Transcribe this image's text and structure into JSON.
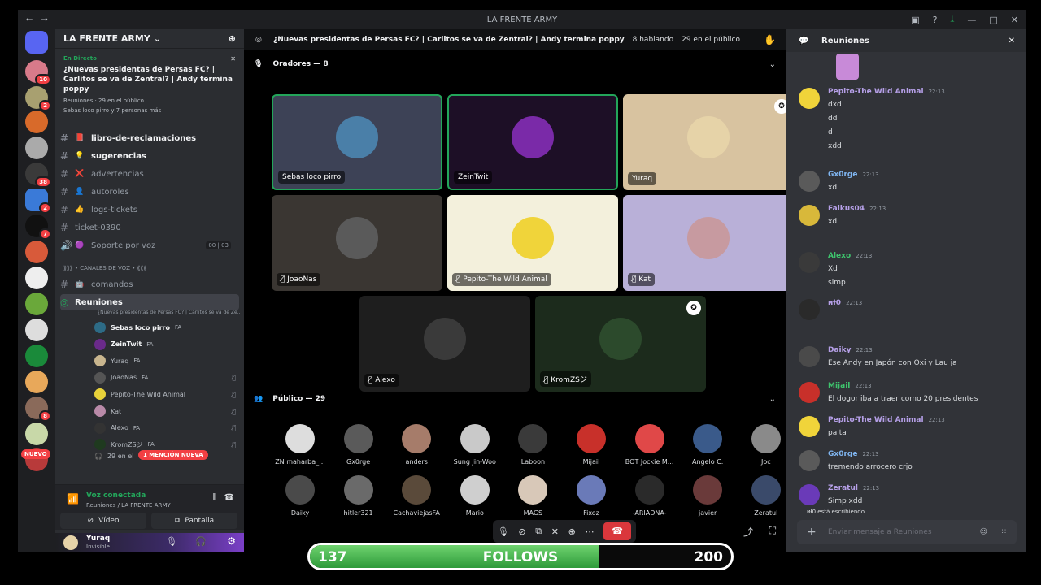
{
  "window": {
    "title": "LA FRENTE ARMY"
  },
  "server_rail": {
    "badges": [
      "10",
      "2",
      "38",
      "2",
      "7",
      "8"
    ],
    "new_label": "NUEVO"
  },
  "sidebar": {
    "server_name": "LA FRENTE ARMY",
    "event": {
      "live": "En Directo",
      "title": "¿Nuevas presidentas de Persas FC? | Carlitos se va de Zentral? | Andy termina poppy",
      "channel": "Reuniones",
      "audience": "29 en el público",
      "attendees": "Sebas loco pirro y 7 personas más"
    },
    "channels": [
      {
        "name": "libro-de-reclamaciones",
        "emoji": "📕",
        "bold": true
      },
      {
        "name": "sugerencias",
        "emoji": "💡",
        "bold": true
      },
      {
        "name": "advertencias",
        "emoji": "❌",
        "bold": false
      },
      {
        "name": "autoroles",
        "emoji": "👤",
        "bold": false
      },
      {
        "name": "logs-tickets",
        "emoji": "👍",
        "bold": false
      },
      {
        "name": "ticket-0390",
        "emoji": "",
        "bold": false
      },
      {
        "name": "Soporte por voz",
        "emoji": "🟣",
        "bold": false,
        "counts": [
          "00",
          "03"
        ]
      }
    ],
    "voice_category": "⟫⟫⟫ • CANALES DE VOZ • ⟪⟪⟪",
    "comandos": "comandos",
    "reuniones": {
      "name": "Reuniones",
      "topic": "¿Nuevas presidentas de Persas FC? | Carlitos se va de Ze..."
    },
    "voice_users": [
      {
        "name": "Sebas loco pirro",
        "tag": "FA",
        "bold": true,
        "color": "#2d6b86"
      },
      {
        "name": "ZeinTwit",
        "tag": "FA",
        "bold": true,
        "color": "#6a2a8a"
      },
      {
        "name": "Yuraq",
        "tag": "FA",
        "bold": false,
        "color": "#c8b58e"
      },
      {
        "name": "JoaoNas",
        "tag": "FA",
        "bold": false,
        "color": "#555555"
      },
      {
        "name": "Pepito-The Wild Animal",
        "tag": "",
        "bold": false,
        "color": "#e8d23a"
      },
      {
        "name": "Kat",
        "tag": "",
        "bold": false,
        "color": "#b98aa8"
      },
      {
        "name": "Alexo",
        "tag": "FA",
        "bold": false,
        "color": "#333333"
      },
      {
        "name": "KromZSジ",
        "tag": "FA",
        "bold": false,
        "color": "#1f3a1f"
      }
    ],
    "audience_row": "29 en el",
    "mention": "1 MENCIÓN NUEVA",
    "voice_connected": "Voz conectada",
    "voice_location": "Reuniones / LA FRENTE ARMY",
    "video_btn": "Vídeo",
    "screen_btn": "Pantalla",
    "user": {
      "name": "Yuraq",
      "status": "Invisible"
    }
  },
  "stage": {
    "title": "¿Nuevas presidentas de Persas FC? | Carlitos se va de Zentral? | Andy termina poppy",
    "speaking": "8 hablando",
    "audience": "29 en el público",
    "speakers_header": "Oradores — 8",
    "public_header": "Público — 29",
    "speakers": [
      {
        "name": "Sebas loco pirro",
        "bg": "#3d4256",
        "speaking": true,
        "muted": false,
        "mod": false,
        "av": "#4a7fa8"
      },
      {
        "name": "ZeinTwit",
        "bg": "#1d0f26",
        "speaking": true,
        "muted": false,
        "mod": false,
        "av": "#7a2aa8"
      },
      {
        "name": "Yuraq",
        "bg": "#d8c3a0",
        "speaking": false,
        "muted": false,
        "mod": true,
        "av": "#e6d3a8"
      },
      {
        "name": "JoaoNas",
        "bg": "#3a3632",
        "speaking": false,
        "muted": true,
        "mod": false,
        "av": "#5a5a5a"
      },
      {
        "name": "Pepito-The Wild Animal",
        "bg": "#f3f0dc",
        "speaking": false,
        "muted": true,
        "mod": false,
        "av": "#f0d43a"
      },
      {
        "name": "Kat",
        "bg": "#b9b0d8",
        "speaking": false,
        "muted": true,
        "mod": false,
        "av": "#c79aa0"
      },
      {
        "name": "Alexo",
        "bg": "#1e1e1e",
        "speaking": false,
        "muted": true,
        "mod": false,
        "av": "#3a3a3a"
      },
      {
        "name": "KromZSジ",
        "bg": "#1c2b1c",
        "speaking": false,
        "muted": true,
        "mod": true,
        "av": "#2c4a2c"
      }
    ],
    "public": [
      {
        "name": "ZN maharba_...",
        "c": "#dddddd"
      },
      {
        "name": "Gx0rge",
        "c": "#5a5a5a"
      },
      {
        "name": "anders",
        "c": "#a67c6a"
      },
      {
        "name": "Sung Jin-Woo",
        "c": "#c9c9c9"
      },
      {
        "name": "Laboon",
        "c": "#3a3a3a"
      },
      {
        "name": "Mijail",
        "c": "#c8302a"
      },
      {
        "name": "BOT Jockie M...",
        "c": "#e04848"
      },
      {
        "name": "Angelo C.",
        "c": "#3a5a8a"
      },
      {
        "name": "Joc",
        "c": "#8a8a8a"
      },
      {
        "name": "Daiky",
        "c": "#4a4a4a"
      },
      {
        "name": "hitler321",
        "c": "#6a6a6a"
      },
      {
        "name": "CachaviejasFA",
        "c": "#5a4a3a"
      },
      {
        "name": "Mario",
        "c": "#cfcfcf"
      },
      {
        "name": "MAGS",
        "c": "#d8c8b8"
      },
      {
        "name": "Fixoz",
        "c": "#6a7ab8"
      },
      {
        "name": "-ARIADNA-",
        "c": "#2a2a2a"
      },
      {
        "name": "javier",
        "c": "#6a3a3a"
      },
      {
        "name": "Zeratul",
        "c": "#3a4a6a"
      }
    ]
  },
  "chat": {
    "channel": "Reuniones",
    "messages": [
      {
        "name": "Pepito-The Wild Animal",
        "color": "#b6a0e8",
        "time": "22:13",
        "lines": [
          "dxd",
          "dd",
          "d",
          "xdd"
        ],
        "av": "#f0d43a"
      },
      {
        "name": "Gx0rge",
        "color": "#7fb5f0",
        "time": "22:13",
        "lines": [
          "xd"
        ],
        "av": "#5a5a5a"
      },
      {
        "name": "Falkus04",
        "color": "#b6a0e8",
        "time": "22:13",
        "lines": [
          "xd"
        ],
        "av": "#d8b83a"
      },
      {
        "name": "Alexo",
        "color": "#3ec46d",
        "time": "22:13",
        "lines": [
          "Xd",
          "simp"
        ],
        "av": "#3a3a3a"
      },
      {
        "name": "ᴎƗ0",
        "color": "#b6a0e8",
        "time": "22:13",
        "lines": [
          ""
        ],
        "av": "#2a2a2a"
      },
      {
        "name": "Daiky",
        "color": "#b6a0e8",
        "time": "22:13",
        "lines": [
          "Ese Andy en Japón con Oxi y Lau ja"
        ],
        "av": "#4a4a4a"
      },
      {
        "name": "Mijail",
        "color": "#3ec46d",
        "time": "22:13",
        "lines": [
          "El dogor iba a traer como 20 presidentes"
        ],
        "av": "#c8302a"
      },
      {
        "name": "Pepito-The Wild Animal",
        "color": "#b6a0e8",
        "time": "22:13",
        "lines": [
          "palta"
        ],
        "av": "#f0d43a"
      },
      {
        "name": "Gx0rge",
        "color": "#7fb5f0",
        "time": "22:13",
        "lines": [
          "tremendo arrocero crjo"
        ],
        "av": "#5a5a5a"
      },
      {
        "name": "Zeratul",
        "color": "#b6a0e8",
        "time": "22:13",
        "lines": [
          "Simp xdd"
        ],
        "av": "#6a3ab8"
      }
    ],
    "typing": "ᴎƗ0 está escribiendo...",
    "input_placeholder": "Enviar mensaje a  Reuniones"
  },
  "follows": {
    "current": "137",
    "label": "FOLLOWS",
    "goal": "200",
    "progress": 0.685
  }
}
